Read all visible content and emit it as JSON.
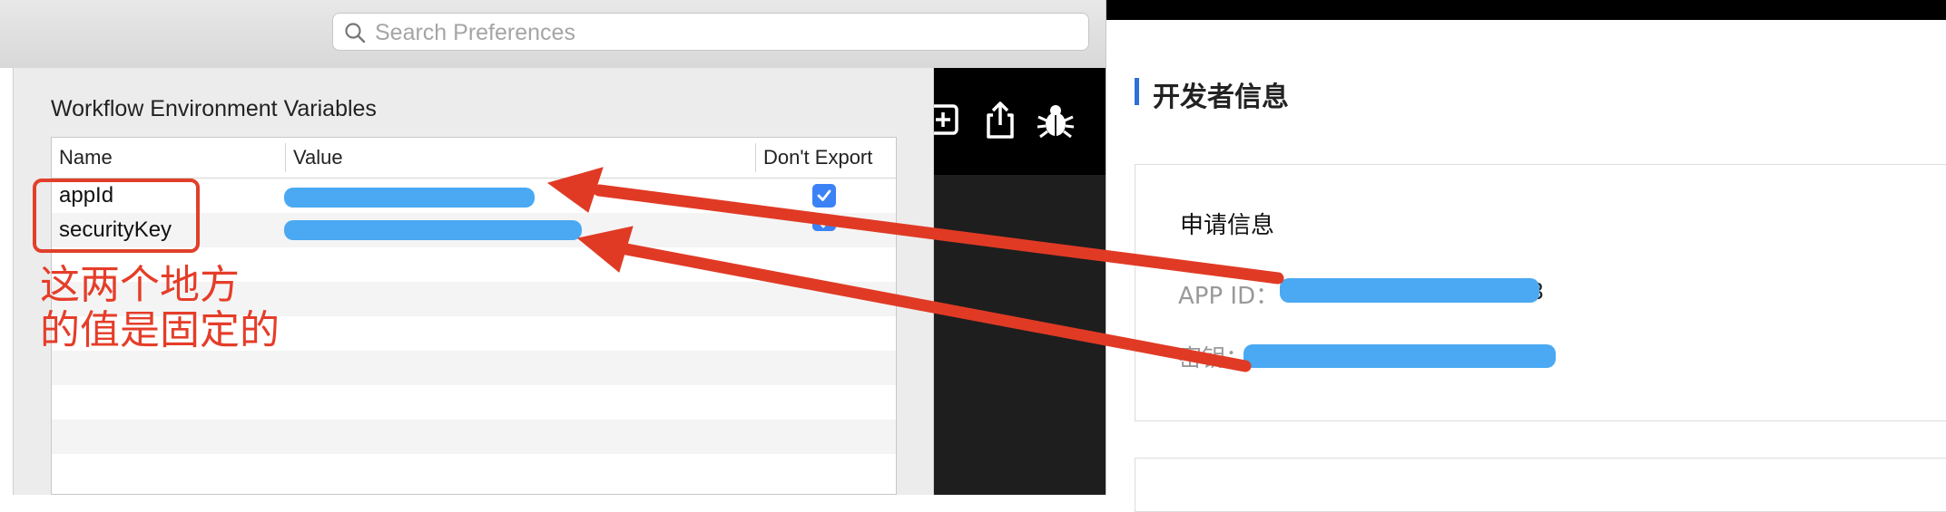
{
  "search": {
    "placeholder": "Search Preferences"
  },
  "sheet": {
    "title": "Workflow Environment Variables",
    "columns": [
      "Name",
      "Value",
      "Don't Export"
    ],
    "rows": [
      {
        "name": "appId",
        "dont_export": true
      },
      {
        "name": "securityKey",
        "dont_export": true
      }
    ]
  },
  "annotation": {
    "line1": "这两个地方",
    "line2": "的值是固定的"
  },
  "dev": {
    "heading": "开发者信息",
    "card_title": "申请信息",
    "app_id_label": "APP ID：",
    "app_id_tail": "3",
    "secret_label": "密钥："
  },
  "colors": {
    "annotation_red": "#e53d29",
    "redaction_blue": "#4aa9f2",
    "checkbox_blue": "#3b82f6",
    "heading_accent": "#2f6fd6"
  },
  "icons": [
    "search-icon",
    "add-icon",
    "share-icon",
    "bug-icon",
    "checkmark-icon"
  ]
}
